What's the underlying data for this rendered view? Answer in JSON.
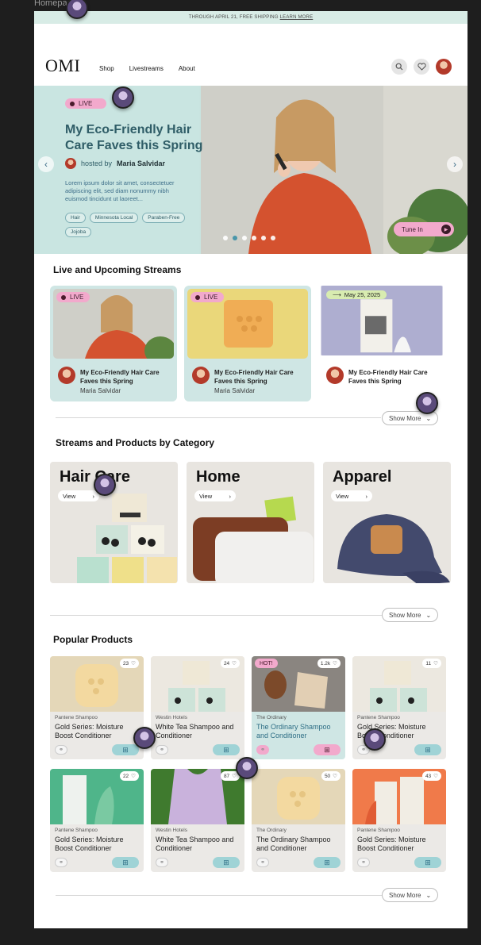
{
  "canvas_label": "Homepage",
  "banner": {
    "text": "THROUGH APRIL 21, FREE SHIPPING",
    "link": "LEARN MORE"
  },
  "nav": {
    "logo": "OMI",
    "links": [
      "Shop",
      "Livestreams",
      "About"
    ],
    "icons": [
      "search-icon",
      "heart-icon",
      "profile-avatar"
    ]
  },
  "hero": {
    "live_label": "LIVE",
    "title": "My Eco-Friendly Hair Care Faves this Spring",
    "hosted_by": "hosted by",
    "host": "Maria Salvidar",
    "description": "Lorem ipsum dolor sit amet, consectetuer adipiscing elit, sed diam nonummy nibh euismod tincidunt ut laoreet...",
    "tags": [
      "Hair",
      "Minnesota Local",
      "Paraben-Free",
      "Jojoba"
    ],
    "cta": "Tune In",
    "carousel": {
      "slides": 6,
      "active": 2
    }
  },
  "live_section": {
    "heading": "Live and Upcoming Streams",
    "streams": [
      {
        "badge": "LIVE",
        "title": "My Eco-Friendly Hair Care Faves this Spring",
        "host": "Maria Salvidar"
      },
      {
        "badge": "LIVE",
        "title": "My Eco-Friendly Hair Care Faves this Spring",
        "host": "Maria Salvidar"
      },
      {
        "badge": "May 25, 2025",
        "title": "My Eco-Friendly Hair Care Faves this Spring",
        "host": ""
      }
    ],
    "show_more": "Show More"
  },
  "category_section": {
    "heading": "Streams and Products by Category",
    "categories": [
      {
        "name": "Hair Care",
        "view": "View"
      },
      {
        "name": "Home",
        "view": "View"
      },
      {
        "name": "Apparel",
        "view": "View"
      }
    ],
    "show_more": "Show More"
  },
  "products_section": {
    "heading": "Popular Products",
    "products": [
      {
        "brand": "Pantene Shampoo",
        "name": "Gold Series: Moisture Boost Conditioner",
        "count": "23",
        "hot": ""
      },
      {
        "brand": "Westin Hotels",
        "name": "White Tea Shampoo and Conditioner",
        "count": "24",
        "hot": ""
      },
      {
        "brand": "The Ordinary",
        "name": "The Ordinary Shampoo and Conditioner",
        "count": "1.2k",
        "hot": "HOT!"
      },
      {
        "brand": "Pantene Shampoo",
        "name": "Gold Series: Moisture Boost Conditioner",
        "count": "11",
        "hot": ""
      },
      {
        "brand": "Pantene Shampoo",
        "name": "Gold Series: Moisture Boost Conditioner",
        "count": "22",
        "hot": ""
      },
      {
        "brand": "Westin Hotels",
        "name": "White Tea Shampoo and Conditioner",
        "count": "87",
        "hot": ""
      },
      {
        "brand": "The Ordinary",
        "name": "The Ordinary Shampoo and Conditioner",
        "count": "50",
        "hot": ""
      },
      {
        "brand": "Pantene Shampoo",
        "name": "Gold Series: Moisture Boost Conditioner",
        "count": "43",
        "hot": ""
      }
    ],
    "show_more": "Show More"
  },
  "colors": {
    "accent_pink": "#f2a9cc",
    "accent_teal": "#9fd3d6",
    "title_teal": "#2f5d67",
    "banner": "#d8ece6"
  }
}
